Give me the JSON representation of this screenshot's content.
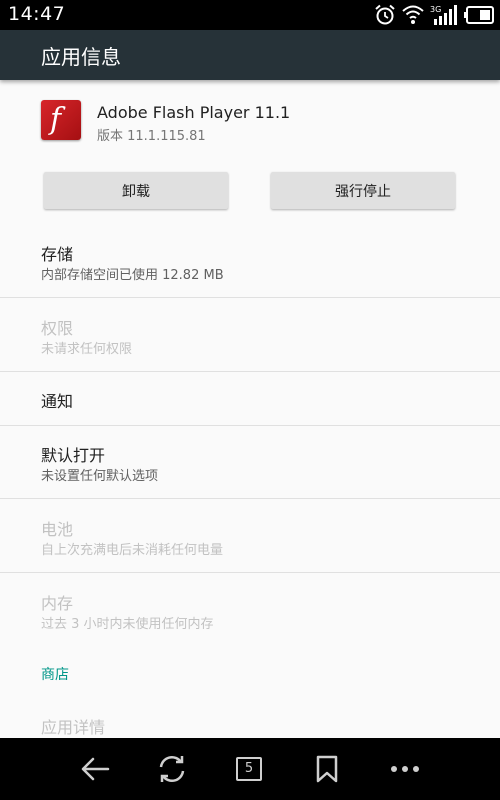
{
  "status_bar": {
    "time": "14:47",
    "network_label": "3G",
    "icons": [
      "alarm-icon",
      "wifi-icon",
      "signal-icon",
      "battery-icon"
    ]
  },
  "app_bar": {
    "title": "应用信息"
  },
  "app": {
    "name": "Adobe Flash Player 11.1",
    "version": "版本 11.1.115.81",
    "icon_glyph": "f",
    "icon_color": "#c8191d"
  },
  "buttons": {
    "uninstall": "卸载",
    "force_stop": "强行停止"
  },
  "prefs": {
    "storage": {
      "title": "存储",
      "summary": "内部存储空间已使用 12.82 MB"
    },
    "permissions": {
      "title": "权限",
      "summary": "未请求任何权限"
    },
    "notifications": {
      "title": "通知"
    },
    "open_by_default": {
      "title": "默认打开",
      "summary": "未设置任何默认选项"
    },
    "battery": {
      "title": "电池",
      "summary": "自上次充满电后未消耗任何电量"
    },
    "memory": {
      "title": "内存",
      "summary": "过去 3 小时内未使用任何内存"
    }
  },
  "store": {
    "category": "商店",
    "app_details": "应用详情"
  },
  "nav_bar": {
    "tab_count": "5",
    "icons": [
      "back-icon",
      "refresh-icon",
      "tabs-icon",
      "bookmark-icon",
      "more-icon"
    ]
  },
  "colors": {
    "app_bar": "#263238",
    "accent": "#009688",
    "disabled_text": "#c2c2c2"
  }
}
